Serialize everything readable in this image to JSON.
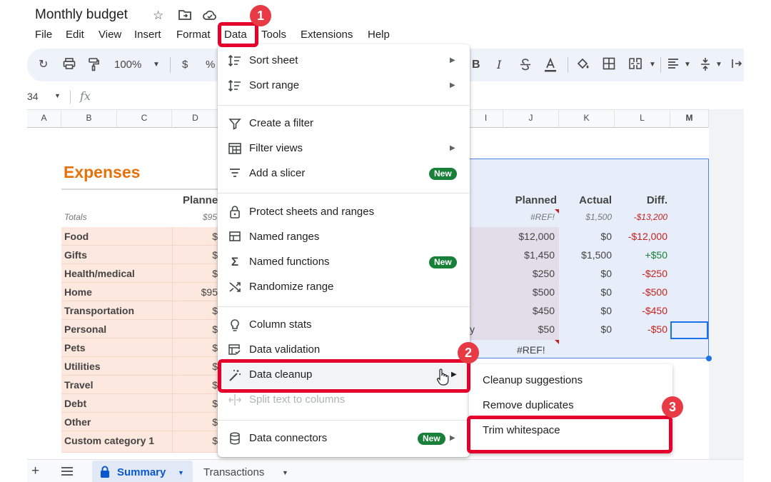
{
  "doc": {
    "title": "Monthly budget"
  },
  "menubar": [
    "File",
    "Edit",
    "View",
    "Insert",
    "Format",
    "Data",
    "Tools",
    "Extensions",
    "Help"
  ],
  "toolbar": {
    "zoom": "100%",
    "currency": "$",
    "percent": "%",
    "bold": "B",
    "italic": "I"
  },
  "formula_bar": {
    "cell_ref": "34",
    "fx": "fx"
  },
  "columns": [
    "A",
    "B",
    "C",
    "D",
    "I",
    "J",
    "K",
    "L",
    "M"
  ],
  "expenses": {
    "title": "Expenses",
    "left_header": "Planne",
    "totals_label": "Totals",
    "totals_planned": "$95",
    "categories": [
      "Food",
      "Gifts",
      "Health/medical",
      "Home",
      "Transportation",
      "Personal",
      "Pets",
      "Utilities",
      "Travel",
      "Debt",
      "Other",
      "Custom category 1"
    ],
    "planned_partial": [
      "$",
      "$",
      "$",
      "$95",
      "$",
      "$",
      "$",
      "$",
      "$",
      "$",
      "$",
      "$"
    ],
    "right_headers": {
      "planned": "Planned",
      "actual": "Actual",
      "diff": "Diff."
    },
    "right_totals": {
      "planned": "#REF!",
      "actual": "$1,500",
      "diff": "-$13,200"
    },
    "rows": [
      {
        "planned": "$12,000",
        "actual": "$0",
        "diff": "-$12,000"
      },
      {
        "planned": "$1,450",
        "actual": "$1,500",
        "diff": "+$50"
      },
      {
        "planned": "$250",
        "actual": "$0",
        "diff": "-$250"
      },
      {
        "planned": "$500",
        "actual": "$0",
        "diff": "-$500"
      },
      {
        "planned": "$450",
        "actual": "$0",
        "diff": "-$450"
      },
      {
        "planned": "$50",
        "actual": "$0",
        "diff": "-$50"
      }
    ],
    "partial_y": "y",
    "pets_ref": "#REF!"
  },
  "data_menu": {
    "sort_sheet": "Sort sheet",
    "sort_range": "Sort range",
    "create_filter": "Create a filter",
    "filter_views": "Filter views",
    "add_slicer": "Add a slicer",
    "protect": "Protect sheets and ranges",
    "named_ranges": "Named ranges",
    "named_functions": "Named functions",
    "randomize": "Randomize range",
    "column_stats": "Column stats",
    "data_validation": "Data validation",
    "data_cleanup": "Data cleanup",
    "split_text": "Split text to columns",
    "data_connectors": "Data connectors",
    "new_badge": "New"
  },
  "cleanup_submenu": {
    "suggestions": "Cleanup suggestions",
    "remove_duplicates": "Remove duplicates",
    "trim_whitespace": "Trim whitespace"
  },
  "sheet_tabs": {
    "summary": "Summary",
    "transactions": "Transactions"
  },
  "annotations": {
    "step1": "1",
    "step2": "2",
    "step3": "3"
  },
  "colors": {
    "annotation_red": "#e4002b",
    "expenses_orange": "#e8710a",
    "new_badge_green": "#188038",
    "selection_blue": "#1a73e8"
  }
}
